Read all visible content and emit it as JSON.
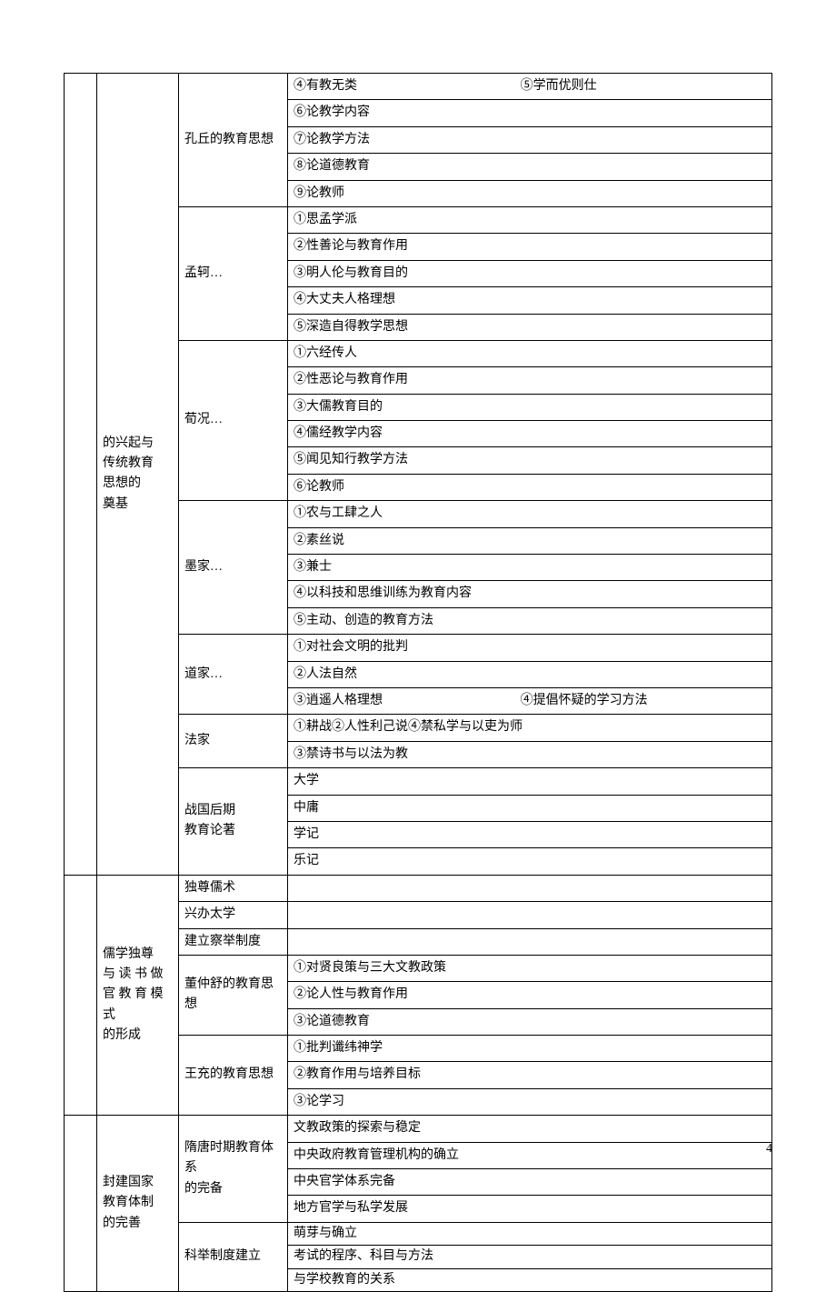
{
  "page_number": "4",
  "section1": {
    "title_lines": [
      "的兴起与",
      "传统教育",
      "思想的",
      "奠基"
    ],
    "groups": [
      {
        "sub": "孔丘的教育思想",
        "rows": [
          {
            "type": "pair",
            "a": "④有教无类",
            "b": "⑤学而优则仕"
          },
          {
            "text": "⑥论教学内容"
          },
          {
            "text": "⑦论教学方法"
          },
          {
            "text": "⑧论道德教育"
          },
          {
            "text": "⑨论教师"
          }
        ]
      },
      {
        "sub": "孟轲…",
        "rows": [
          {
            "text": "①思孟学派"
          },
          {
            "text": "②性善论与教育作用"
          },
          {
            "text": "③明人伦与教育目的"
          },
          {
            "text": "④大丈夫人格理想"
          },
          {
            "text": "⑤深造自得教学思想"
          }
        ]
      },
      {
        "sub": "荀况…",
        "rows": [
          {
            "text": "①六经传人"
          },
          {
            "text": "②性恶论与教育作用"
          },
          {
            "text": "③大儒教育目的"
          },
          {
            "text": "④儒经教学内容"
          },
          {
            "text": "⑤闻见知行教学方法"
          },
          {
            "text": "⑥论教师"
          }
        ]
      },
      {
        "sub": "墨家…",
        "rows": [
          {
            "text": "①农与工肆之人"
          },
          {
            "text": "②素丝说"
          },
          {
            "text": "③兼士"
          },
          {
            "text": "④以科技和思维训练为教育内容"
          },
          {
            "text": "⑤主动、创造的教育方法"
          }
        ]
      },
      {
        "sub": "道家…",
        "rows": [
          {
            "text": "①对社会文明的批判"
          },
          {
            "text": "②人法自然"
          },
          {
            "type": "pair",
            "a": "③逍遥人格理想",
            "b": "④提倡怀疑的学习方法"
          }
        ]
      },
      {
        "sub": "法家",
        "rows": [
          {
            "text": "①耕战②人性利己说④禁私学与以吏为师"
          },
          {
            "text": "③禁诗书与以法为教"
          }
        ]
      },
      {
        "sub_lines": [
          "战国后期",
          "教育论著"
        ],
        "rows": [
          {
            "text": "大学"
          },
          {
            "text": "中庸"
          },
          {
            "text": "学记"
          },
          {
            "text": "乐记"
          }
        ]
      }
    ]
  },
  "section2": {
    "title_lines": [
      "儒学独尊",
      "与 读 书 做",
      "官 教 育 模",
      "式",
      "的形成"
    ],
    "groups": [
      {
        "sub": "独尊儒术",
        "rows": [
          {
            "text": ""
          }
        ]
      },
      {
        "sub": "兴办太学",
        "rows": [
          {
            "text": ""
          }
        ]
      },
      {
        "sub": "建立察举制度",
        "rows": [
          {
            "text": ""
          }
        ]
      },
      {
        "sub": "董仲舒的教育思想",
        "rows": [
          {
            "text": "①对贤良策与三大文教政策"
          },
          {
            "text": "②论人性与教育作用"
          },
          {
            "text": "③论道德教育"
          }
        ]
      },
      {
        "sub": "王充的教育思想",
        "rows": [
          {
            "text": "①批判谶纬神学"
          },
          {
            "text": "②教育作用与培养目标"
          },
          {
            "text": "③论学习"
          }
        ]
      }
    ]
  },
  "section3": {
    "title_lines": [
      "封建国家",
      "教育体制",
      "的完善"
    ],
    "groups": [
      {
        "sub_lines": [
          "隋唐时期教育体系",
          "的完备"
        ],
        "rows": [
          {
            "text": "文教政策的探索与稳定"
          },
          {
            "text": "中央政府教育管理机构的确立"
          },
          {
            "text": "中央官学体系完备"
          },
          {
            "text": "地方官学与私学发展"
          }
        ]
      },
      {
        "sub": "科举制度建立",
        "rows": [
          {
            "text": "萌芽与确立"
          },
          {
            "text": "考试的程序、科目与方法"
          },
          {
            "text": "与学校教育的关系"
          }
        ]
      }
    ]
  }
}
